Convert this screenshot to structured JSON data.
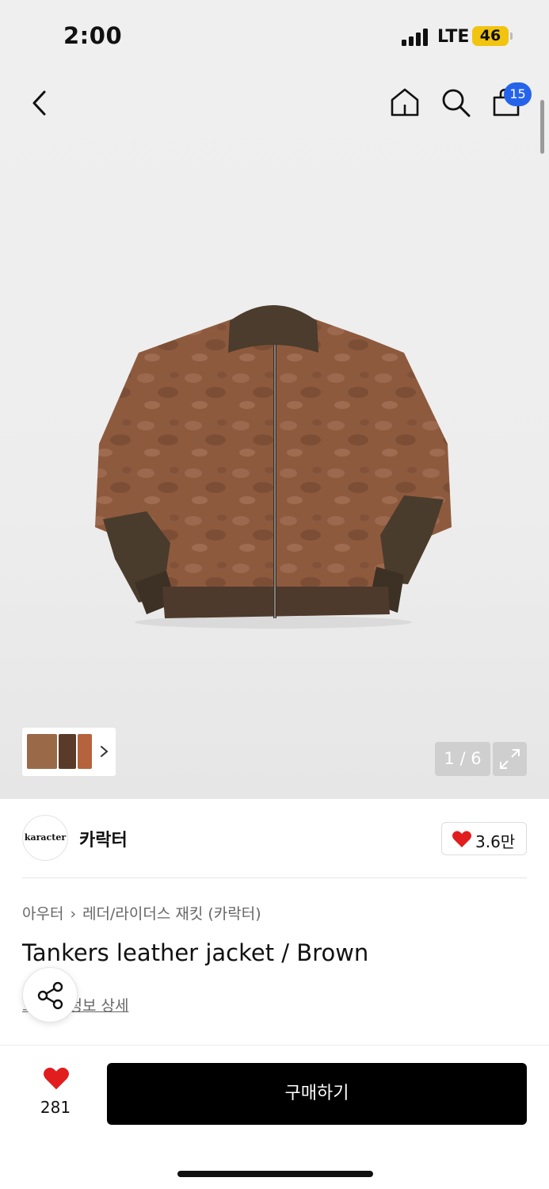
{
  "status_bar": {
    "time": "2:00",
    "network": "LTE",
    "battery": "46"
  },
  "nav": {
    "back_icon": "chevron-left-icon",
    "home_icon": "home-icon",
    "search_icon": "search-icon",
    "bag_icon": "shopping-bag-icon",
    "bag_badge": "15"
  },
  "gallery": {
    "current": 1,
    "total": 6,
    "page_label": "1 / 6",
    "expand_icon": "expand-icon",
    "thumbnail_colors": [
      "#9a6a48",
      "#5a3b2a",
      "#b4633c"
    ]
  },
  "brand": {
    "logo_text": "karacter",
    "name": "카락터",
    "like_count": "3.6만"
  },
  "product": {
    "breadcrumb": [
      "아우터",
      "레더/라이더스 재킷 (카락터)"
    ],
    "title": "Tankers leather jacket / Brown",
    "partial_link": "브랜드 정보 상세"
  },
  "bottom_bar": {
    "wish_count": "281",
    "buy_label": "구매하기"
  },
  "colors": {
    "accent_red": "#e11d1d",
    "badge_blue": "#2563eb",
    "battery_yellow": "#f1c40f",
    "buy_button": "#000000"
  }
}
